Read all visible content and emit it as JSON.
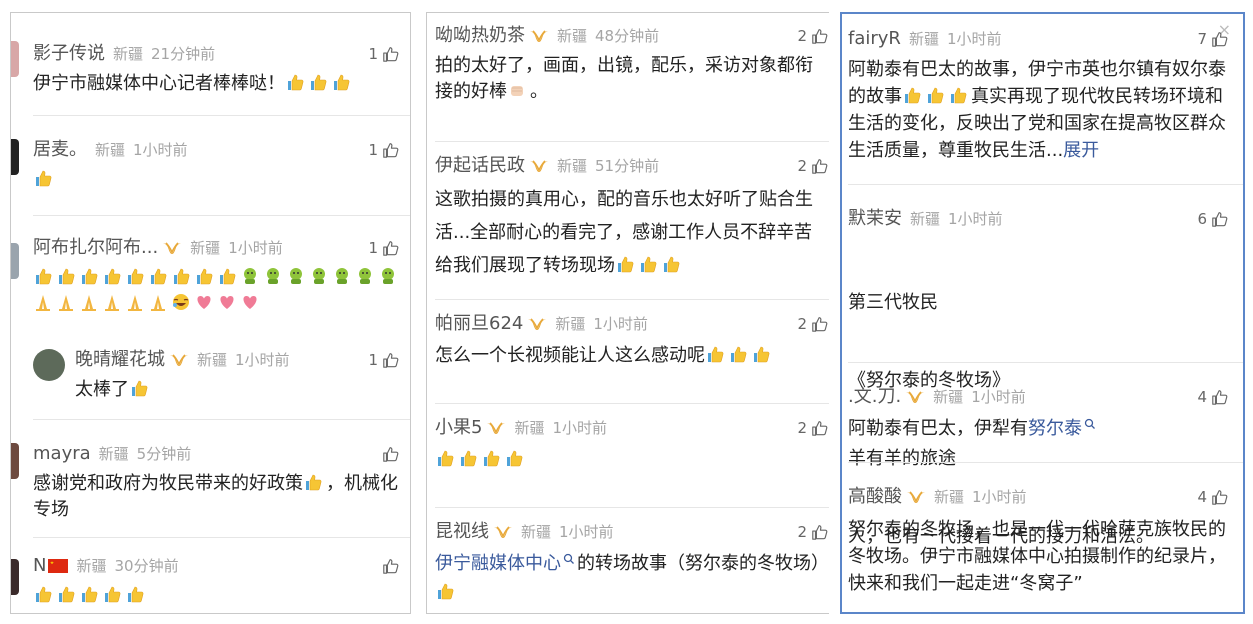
{
  "panels": [
    {
      "comments": [
        {
          "name": "影子传说",
          "badge": false,
          "location": "新疆",
          "time": "21分钟前",
          "likes": "1",
          "text": "伊宁市融媒体中心记者棒棒哒！",
          "emojis": [
            "thumb",
            "thumb",
            "thumb"
          ]
        },
        {
          "name": "居麦。",
          "badge": false,
          "location": "新疆",
          "time": "1小时前",
          "likes": "1",
          "text": "",
          "emojis": [
            "thumb"
          ]
        },
        {
          "name": "阿布扎尔阿布...",
          "badge": true,
          "location": "新疆",
          "time": "1小时前",
          "likes": "1",
          "text": "",
          "emojis": [
            "thumb",
            "thumb",
            "thumb",
            "thumb",
            "thumb",
            "thumb",
            "thumb",
            "thumb",
            "thumb",
            "face",
            "face",
            "face",
            "face",
            "face",
            "face",
            "face",
            "pray",
            "pray",
            "pray",
            "pray",
            "pray",
            "pray",
            "laugh",
            "heart",
            "heart",
            "heart"
          ]
        },
        {
          "name": "晚晴耀花城",
          "badge": true,
          "location": "新疆",
          "time": "1小时前",
          "likes": "1",
          "text": "太棒了",
          "emojis": [
            "thumb"
          ],
          "reply": true
        },
        {
          "name": "mayra",
          "badge": false,
          "location": "新疆",
          "time": "5分钟前",
          "likes": "",
          "text": "感谢党和政府为牧民带来的好政策",
          "text2": "，机械化专场",
          "emojis": [
            "thumb"
          ]
        },
        {
          "name": "N",
          "badge": false,
          "flag": true,
          "location": "新疆",
          "time": "30分钟前",
          "likes": "",
          "text": "",
          "emojis": [
            "thumb",
            "thumb",
            "thumb",
            "thumb",
            "thumb"
          ]
        }
      ]
    },
    {
      "comments": [
        {
          "name": "呦呦热奶茶",
          "badge": true,
          "location": "新疆",
          "time": "48分钟前",
          "likes": "2",
          "text": "拍的太好了，画面，出镜，配乐，采访对象都衔接的好棒",
          "tail": "。"
        },
        {
          "name": "伊起话民政",
          "badge": true,
          "location": "新疆",
          "time": "51分钟前",
          "likes": "2",
          "text": "这歌拍摄的真用心，配的音乐也太好听了贴合生活...全部耐心的看完了，感谢工作人员不辞辛苦给我们展现了转场现场"
        },
        {
          "name": "帕丽旦624",
          "badge": true,
          "location": "新疆",
          "time": "1小时前",
          "likes": "2",
          "text": "怎么一个长视频能让人这么感动呢"
        },
        {
          "name": "小果5",
          "badge": true,
          "location": "新疆",
          "time": "1小时前",
          "likes": "2",
          "text": ""
        },
        {
          "name": "昆视线",
          "badge": true,
          "location": "新疆",
          "time": "1小时前",
          "likes": "2",
          "link": "伊宁融媒体中心",
          "text": "的转场故事（努尔泰的冬牧场）"
        }
      ]
    },
    {
      "comments": [
        {
          "name": "fairyR",
          "badge": false,
          "location": "新疆",
          "time": "1小时前",
          "likes": "7",
          "text1": "阿勒泰有巴太的故事，伊宁市英也尔镇有奴尔泰的故事",
          "text2": "真实再现了现代牧民转场环境和生活的变化，反映出了党和国家在提高牧区群众生活质量，尊重牧民生活...",
          "expand": "展开"
        },
        {
          "name": "默茉安",
          "badge": false,
          "location": "新疆",
          "time": "1小时前",
          "likes": "6",
          "lines": [
            "第三代牧民",
            "《努尔泰的冬牧场》",
            "羊有羊的旅途",
            "人，也有一代接着一代的接力和活法。"
          ]
        },
        {
          "name": ".文.刀.",
          "badge": true,
          "location": "新疆",
          "time": "1小时前",
          "likes": "4",
          "text": "阿勒泰有巴太，伊犁有",
          "link": "努尔泰"
        },
        {
          "name": "高酸酸",
          "badge": true,
          "location": "新疆",
          "time": "1小时前",
          "likes": "4",
          "text": "努尔泰的冬牧场，也是一代一代哈萨克族牧民的冬牧场。伊宁市融媒体中心拍摄制作的纪录片，快来和我们一起走进“冬窝子”"
        }
      ],
      "close": "×"
    }
  ],
  "colors": {
    "link": "#3a5a9c",
    "highlight_border": "#5b86c9",
    "badge": "#e8a93a",
    "meta": "#a5a5a5"
  }
}
